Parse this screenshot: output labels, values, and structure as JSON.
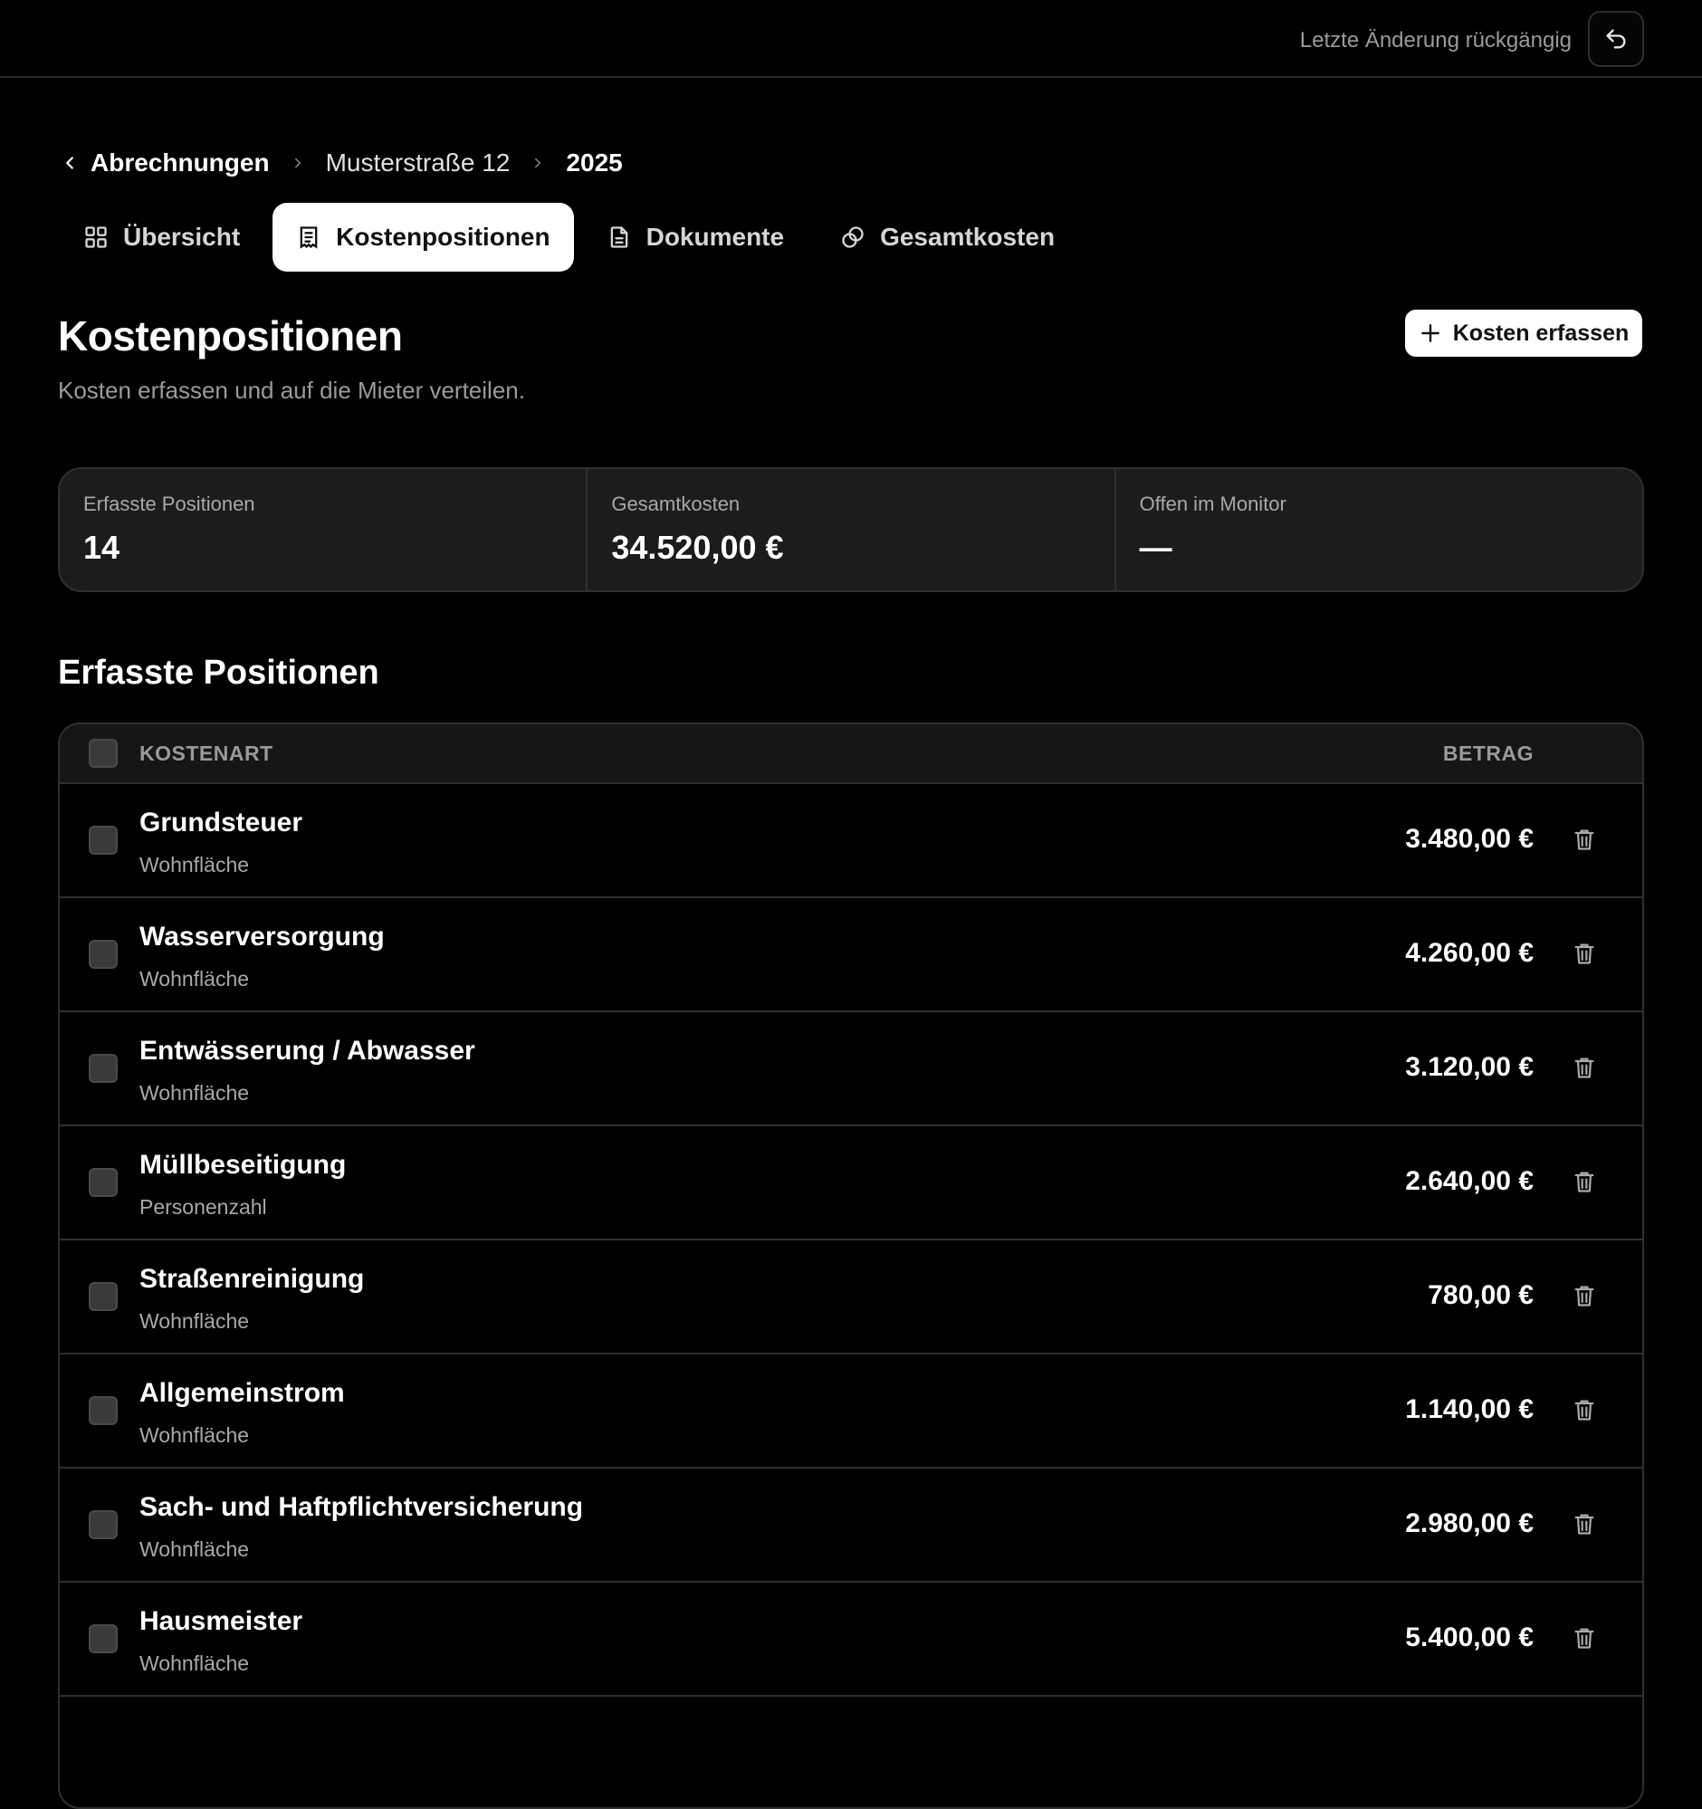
{
  "topbar": {
    "undo_label": "Letzte Änderung rückgängig",
    "undo_icon": "undo-icon"
  },
  "breadcrumb": {
    "back": "Abrechnungen",
    "property": "Musterstraße 12",
    "year": "2025"
  },
  "tabs": [
    {
      "label": "Übersicht",
      "icon": "grid-icon",
      "active": false
    },
    {
      "label": "Kostenpositionen",
      "icon": "receipt-icon",
      "active": true
    },
    {
      "label": "Dokumente",
      "icon": "document-icon",
      "active": false
    },
    {
      "label": "Gesamtkosten",
      "icon": "coins-icon",
      "active": false
    }
  ],
  "page": {
    "title": "Kostenpositionen",
    "subtitle": "Kosten erfassen und auf die Mieter verteilen.",
    "add_button": "Kosten erfassen"
  },
  "stats": [
    {
      "label": "Erfasste Positionen",
      "value": "14"
    },
    {
      "label": "Gesamtkosten",
      "value": "34.520,00 €"
    },
    {
      "label": "Offen im Monitor",
      "value": "—"
    }
  ],
  "section": {
    "title": "Erfasste Positionen"
  },
  "table": {
    "col_kostenart": "KOSTENART",
    "col_betrag": "BETRAG",
    "rows": [
      {
        "name": "Grundsteuer",
        "key": "Wohnfläche",
        "amount": "3.480,00 €"
      },
      {
        "name": "Wasserversorgung",
        "key": "Wohnfläche",
        "amount": "4.260,00 €"
      },
      {
        "name": "Entwässerung / Abwasser",
        "key": "Wohnfläche",
        "amount": "3.120,00 €"
      },
      {
        "name": "Müllbeseitigung",
        "key": "Personenzahl",
        "amount": "2.640,00 €"
      },
      {
        "name": "Straßenreinigung",
        "key": "Wohnfläche",
        "amount": "780,00 €"
      },
      {
        "name": "Allgemeinstrom",
        "key": "Wohnfläche",
        "amount": "1.140,00 €"
      },
      {
        "name": "Sach- und Haftpflichtversicherung",
        "key": "Wohnfläche",
        "amount": "2.980,00 €"
      },
      {
        "name": "Hausmeister",
        "key": "Wohnfläche",
        "amount": "5.400,00 €"
      }
    ]
  },
  "colors": {
    "background": "#000000",
    "surface": "#1c1c1e",
    "border": "#2f2f2f",
    "muted_text": "#9a9a9a",
    "accent": "#ffffff"
  }
}
